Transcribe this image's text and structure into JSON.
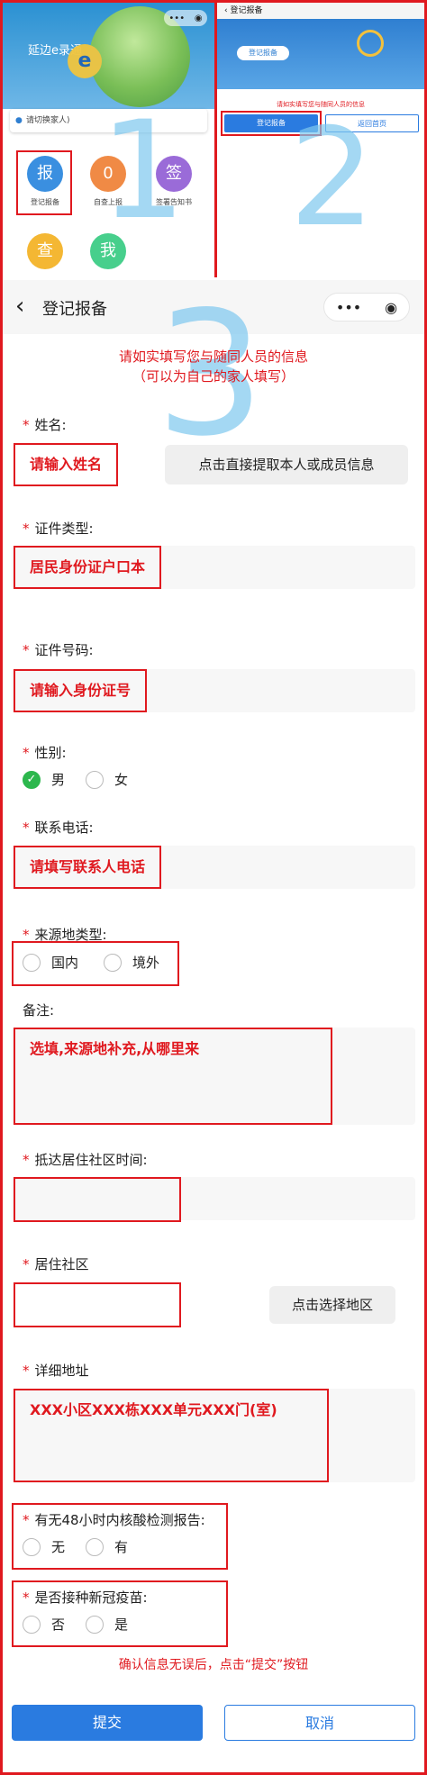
{
  "panel1": {
    "app_title": "延边e录通",
    "user_label": "*",
    "user_text": "请切换家人)",
    "apps": [
      {
        "label": "登记报备",
        "glyph": "报",
        "color": "#3a8fe0"
      },
      {
        "label": "自查上报",
        "glyph": "0",
        "color": "#f08a45"
      },
      {
        "label": "签署告知书",
        "glyph": "签",
        "color": "#9a6bd8"
      },
      {
        "label": "",
        "glyph": "查",
        "color": "#f4b733"
      },
      {
        "label": "",
        "glyph": "我",
        "color": "#47cf8c"
      }
    ],
    "big_number": "1"
  },
  "panel2": {
    "header_title": "登记报备",
    "banner_button": "登记报备",
    "note": "请如实填写您与随同人员的信息",
    "button_register": "登记报备",
    "button_home": "返回首页",
    "big_number": "2"
  },
  "form": {
    "nav_title": "登记报备",
    "big_number": "3",
    "intro_line1": "请如实填写您与随同人员的信息",
    "intro_line2": "（可以为自己的家人填写）",
    "name_label": "姓名:",
    "name_placeholder": "请输入姓名",
    "fetch_button": "点击直接提取本人或成员信息",
    "id_type_label": "证件类型:",
    "id_type_value": "居民身份证户口本",
    "id_number_label": "证件号码:",
    "id_number_placeholder": "请输入身份证号",
    "gender_label": "性别:",
    "gender_male": "男",
    "gender_female": "女",
    "phone_label": "联系电话:",
    "phone_placeholder": "请填写联系人电话",
    "origin_label": "来源地类型:",
    "origin_domestic": "国内",
    "origin_abroad": "境外",
    "remark_label": "备注:",
    "remark_placeholder": "选填,来源地补充,从哪里来",
    "arrival_label": "抵达居住社区时间:",
    "community_label": "居住社区",
    "select_area_button": "点击选择地区",
    "address_label": "详细地址",
    "address_placeholder": "XXX小区XXX栋XXX单元XXX门(室)",
    "nucleic_label": "有无48小时内核酸检测报告:",
    "nucleic_no": "无",
    "nucleic_yes": "有",
    "vaccine_label": "是否接种新冠疫苗:",
    "vaccine_no": "否",
    "vaccine_yes": "是",
    "confirm_text": "确认信息无误后，点击“提交”按钮",
    "submit": "提交",
    "cancel": "取消"
  }
}
